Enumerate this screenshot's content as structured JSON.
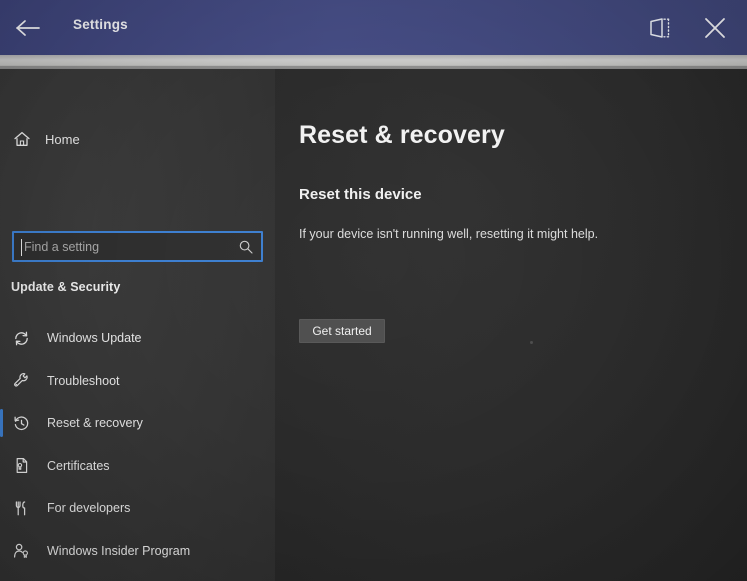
{
  "window": {
    "titlebar": {
      "back_label": "back-arrow",
      "title": "Settings",
      "project_icon": "project-screen-icon",
      "close_icon": "close-icon"
    },
    "accent_color": "#3d7fd0",
    "titlebar_color": "#41487d",
    "sidebar_color": "#363636",
    "content_color": "#2b2b2b"
  },
  "sidebar": {
    "home": {
      "label": "Home",
      "icon": "home-icon"
    },
    "search": {
      "value": "",
      "placeholder": "Find a setting",
      "icon": "search-icon"
    },
    "group_heading": "Update & Security",
    "items": [
      {
        "label": "Windows Update",
        "icon": "refresh-icon",
        "selected": false
      },
      {
        "label": "Troubleshoot",
        "icon": "wrench-icon",
        "selected": false
      },
      {
        "label": "Reset & recovery",
        "icon": "history-clock-icon",
        "selected": true
      },
      {
        "label": "Certificates",
        "icon": "certificate-document-icon",
        "selected": false
      },
      {
        "label": "For developers",
        "icon": "developer-tools-icon",
        "selected": false
      },
      {
        "label": "Windows Insider Program",
        "icon": "insider-person-icon",
        "selected": false
      }
    ]
  },
  "content": {
    "page_title": "Reset & recovery",
    "section_title": "Reset this device",
    "section_description": "If your device isn't running well, resetting it might help.",
    "get_started_label": "Get started"
  }
}
